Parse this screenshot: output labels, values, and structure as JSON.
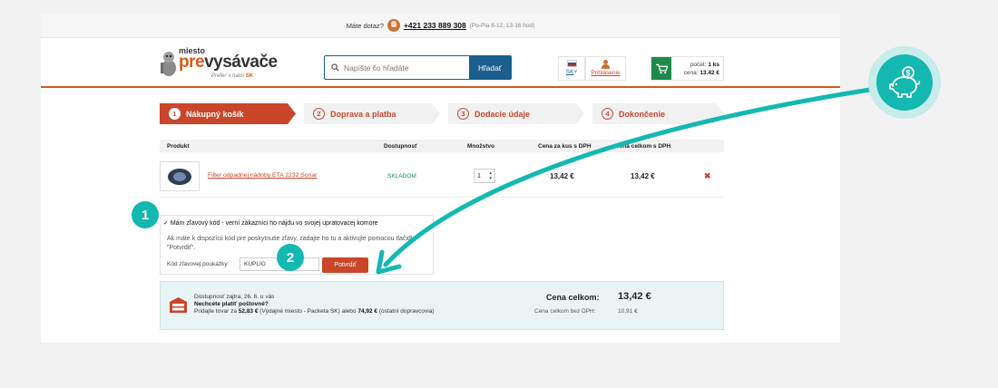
{
  "topbar": {
    "question": "Máte dotaz?",
    "phone": "+421 233 889 308",
    "hours": "(Po-Pia 8-12, 13-16 hod)"
  },
  "header": {
    "logo_top": "miesto",
    "logo_pre": "pre",
    "logo_main": "vysávače",
    "logo_sub": "Prefer´s nami",
    "logo_sk": "SK",
    "search_placeholder": "Napíšte čo hľadáte",
    "search_button": "Hľadať",
    "lang": "SK",
    "login": "Prihlásenie",
    "cart_count_label": "počet:",
    "cart_count": "1 ks",
    "cart_price_label": "cena:",
    "cart_price": "13.42 €"
  },
  "steps": [
    {
      "num": "1",
      "label": "Nákupný košík"
    },
    {
      "num": "2",
      "label": "Doprava a platba"
    },
    {
      "num": "3",
      "label": "Dodacie údaje"
    },
    {
      "num": "4",
      "label": "Dokončenie"
    }
  ],
  "table": {
    "headers": {
      "product": "Produkt",
      "availability": "Dostupnosť",
      "quantity": "Množstvo",
      "unit_price": "Cena za kus s DPH",
      "total_price": "Cena celkom s DPH"
    },
    "rows": [
      {
        "name": "Filter odpadnej nádoby ETA 2232 Sonar",
        "availability": "SKLADOM",
        "quantity": "1",
        "unit_price": "13,42 €",
        "total_price": "13,42 €",
        "delete": "✖"
      }
    ]
  },
  "coupon": {
    "checkbox_label": "Mám zľavový kód - verní zákazníci ho nájdu vo svojej upratovacej komore",
    "description": "Ak máte k dispozícii kód pre poskytnutie zľavy, zadajte ho tu a aktivujte pomocou tlačidla \"Potvrdiť\".",
    "field_label": "Kód zľavovej poukážky:",
    "field_value": "KUPLIO",
    "confirm_button": "Potvrdiť"
  },
  "summary": {
    "delivery_line": "Dostupnosť zajtra, 26. 6. u vás",
    "free_shipping_question": "Nechcete platiť poštovné?",
    "free_shipping_prefix": "Pridajte tovar za",
    "amount_1": "52,83 €",
    "free_shipping_middle": "(Výdajné miesto - Packeta SK) alebo",
    "amount_2": "74,92 €",
    "free_shipping_suffix": "(ostatní dopravcovia)",
    "total_label": "Cena celkom:",
    "total_value": "13,42 €",
    "no_vat_label": "Cena celkom bez DPH:",
    "no_vat_value": "10,91 €"
  },
  "overlay": {
    "badge_1": "1",
    "badge_2": "2",
    "accent_color": "#13b8b1",
    "icon": "piggy-bank-icon"
  }
}
